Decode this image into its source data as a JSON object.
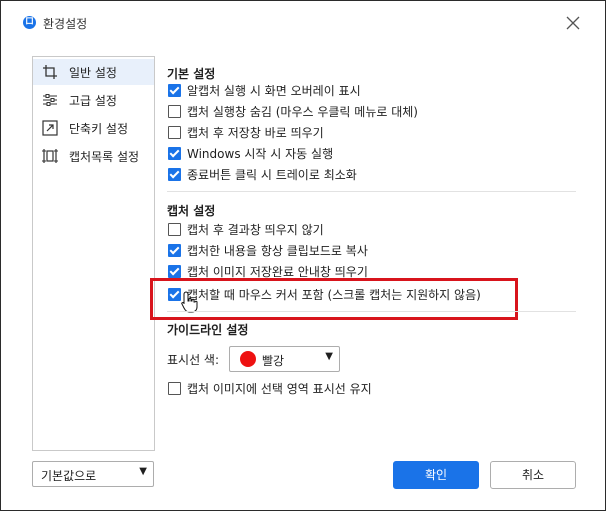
{
  "window": {
    "title": "환경설정",
    "close_icon": "close-icon",
    "app_icon": "capture-app-icon",
    "app_icon_glyph": "ロ"
  },
  "sidebar": {
    "items": [
      {
        "label": "일반 설정",
        "icon": "crop-icon",
        "active": true
      },
      {
        "label": "고급 설정",
        "icon": "sliders-icon",
        "active": false
      },
      {
        "label": "단축키 설정",
        "icon": "shortcut-arrow-icon",
        "active": false
      },
      {
        "label": "캡처목록 설정",
        "icon": "capture-list-icon",
        "active": false
      }
    ],
    "reset_dropdown": "기본값으로"
  },
  "general": {
    "title": "기본 설정",
    "options": [
      {
        "label": "알캡처 실행 시 화면 오버레이 표시",
        "checked": true
      },
      {
        "label": "캡처 실행창 숨김 (마우스 우클릭 메뉴로 대체)",
        "checked": false
      },
      {
        "label": "캡처 후 저장창 바로 띄우기",
        "checked": false
      },
      {
        "label": "Windows 시작 시 자동 실행",
        "checked": true
      },
      {
        "label": "종료버튼 클릭 시 트레이로 최소화",
        "checked": true
      }
    ]
  },
  "capture": {
    "title": "캡처 설정",
    "options": [
      {
        "label": "캡처 후 결과창 띄우지 않기",
        "checked": false
      },
      {
        "label": "캡처한 내용을 항상 클립보드로 복사",
        "checked": true
      },
      {
        "label": "캡처 이미지 저장완료 안내창 띄우기",
        "checked": true
      },
      {
        "label": "캡처할 때 마우스 커서 포함 (스크롤 캡처는 지원하지 않음)",
        "checked": true
      }
    ]
  },
  "guideline": {
    "title": "가이드라인 설정",
    "color_label": "표시선 색:",
    "color_value": "빨강",
    "color_swatch": "#ee1111",
    "keep_option": {
      "label": "캡처 이미지에 선택 영역 표시선 유지",
      "checked": false
    }
  },
  "buttons": {
    "ok": "확인",
    "cancel": "취소"
  },
  "colors": {
    "accent": "#1a73e8",
    "highlight_box": "#d8141c"
  }
}
